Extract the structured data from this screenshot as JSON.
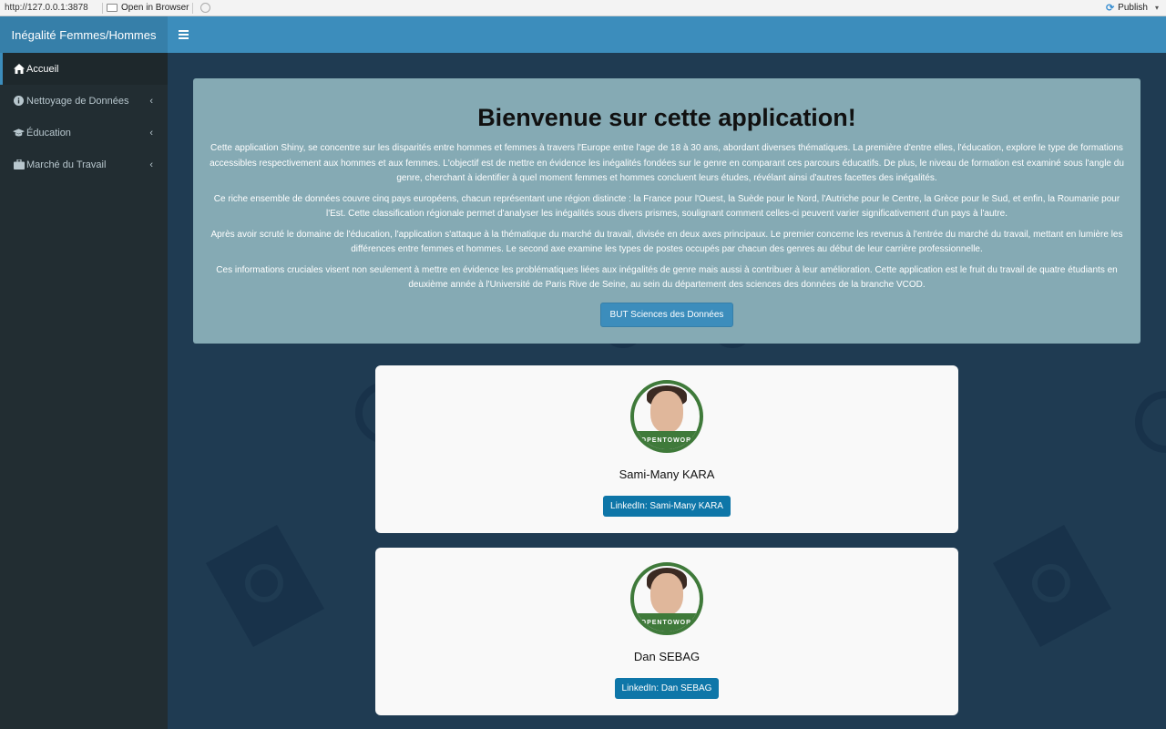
{
  "browser": {
    "url": "http://127.0.0.1:3878",
    "open_in_browser": "Open in Browser",
    "publish": "Publish"
  },
  "header": {
    "title": "Inégalité Femmes/Hommes",
    "toggle_icon": "hamburger-icon"
  },
  "sidebar": {
    "items": [
      {
        "label": "Accueil",
        "icon": "home-icon",
        "active": true
      },
      {
        "label": "Nettoyage de Données",
        "icon": "info-icon",
        "active": false
      },
      {
        "label": "Éducation",
        "icon": "graduation-cap-icon",
        "active": false
      },
      {
        "label": "Marché du Travail",
        "icon": "briefcase-icon",
        "active": false
      }
    ]
  },
  "welcome": {
    "title": "Bienvenue sur cette application!",
    "paragraphs": [
      "Cette application Shiny, se concentre sur les disparités entre hommes et femmes à travers l'Europe entre l'age de 18 à 30 ans, abordant diverses thématiques. La première d'entre elles, l'éducation, explore le type de formations accessibles respectivement aux hommes et aux femmes. L'objectif est de mettre en évidence les inégalités fondées sur le genre en comparant ces parcours éducatifs. De plus, le niveau de formation est examiné sous l'angle du genre, cherchant à identifier à quel moment femmes et hommes concluent leurs études, révélant ainsi d'autres facettes des inégalités.",
      "Ce riche ensemble de données couvre cinq pays européens, chacun représentant une région distincte : la France pour l'Ouest, la Suède pour le Nord, l'Autriche pour le Centre, la Grèce pour le Sud, et enfin, la Roumanie pour l'Est. Cette classification régionale permet d'analyser les inégalités sous divers prismes, soulignant comment celles-ci peuvent varier significativement d'un pays à l'autre.",
      "Après avoir scruté le domaine de l'éducation, l'application s'attaque à la thématique du marché du travail, divisée en deux axes principaux. Le premier concerne les revenus à l'entrée du marché du travail, mettant en lumière les différences entre femmes et hommes. Le second axe examine les types de postes occupés par chacun des genres au début de leur carrière professionnelle.",
      "Ces informations cruciales visent non seulement à mettre en évidence les problématiques liées aux inégalités de genre mais aussi à contribuer à leur amélioration. Cette application est le fruit du travail de quatre étudiants en deuxième année à l'Université de Paris Rive de Seine, au sein du département des sciences des données de la branche VCOD."
    ],
    "button": "BUT Sciences des Données"
  },
  "profiles": [
    {
      "name": "Sami-Many KARA",
      "badge": "#OPENTOWORK",
      "linkedin": "LinkedIn: Sami-Many KARA"
    },
    {
      "name": "Dan SEBAG",
      "badge": "#OPENTOWORK",
      "linkedin": "LinkedIn: Dan SEBAG"
    }
  ],
  "colors": {
    "header": "#3c8dbc",
    "logo_bg": "#367fa9",
    "sidebar_bg": "#222d32",
    "content_bg": "#1f3b52",
    "welcome_bg": "#85aab4",
    "linkedin": "#0e76a8"
  }
}
